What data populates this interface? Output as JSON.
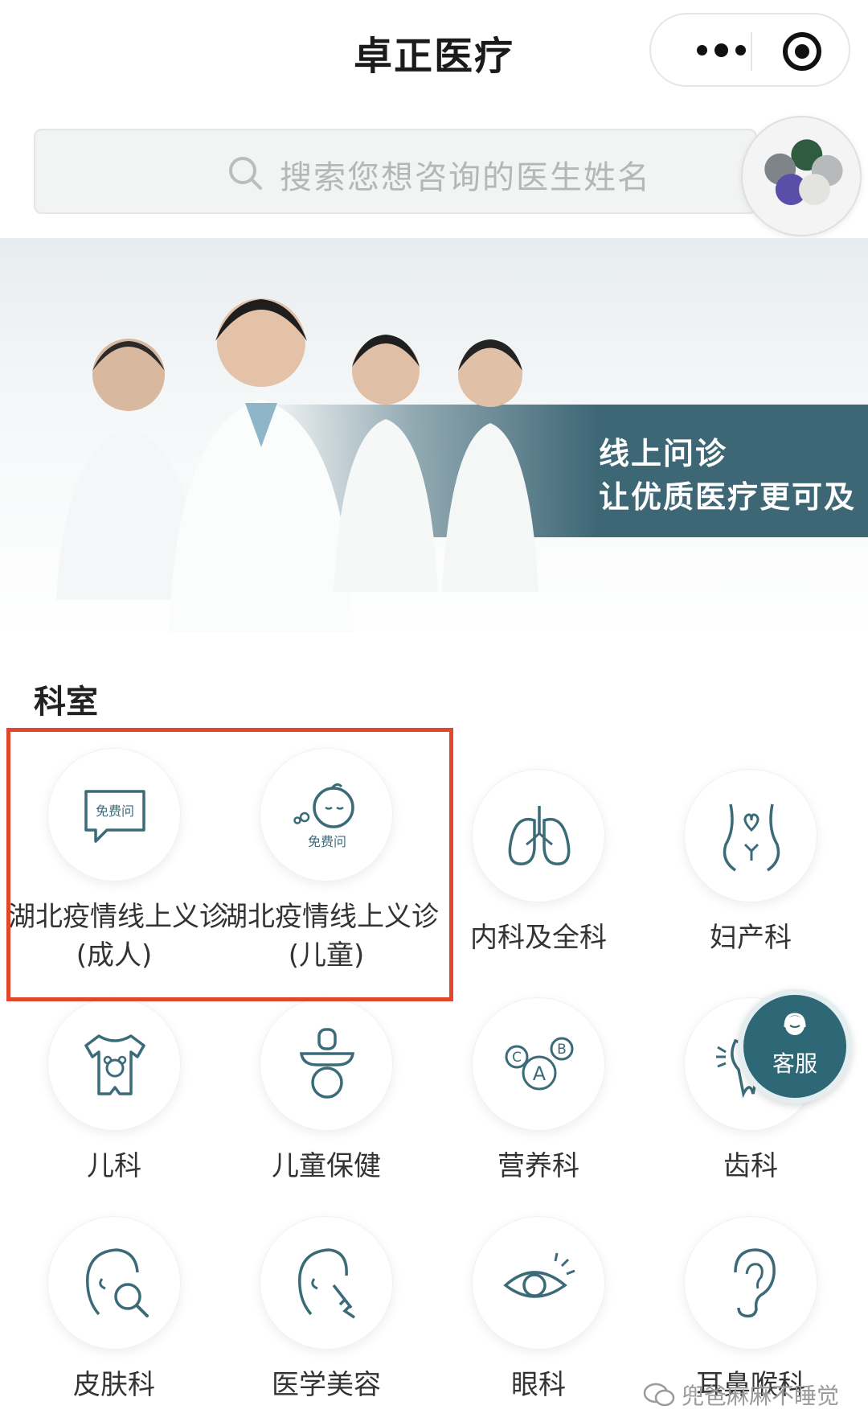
{
  "header": {
    "title": "卓正医疗"
  },
  "search": {
    "placeholder": "搜索您想咨询的医生姓名"
  },
  "banner": {
    "line1": "线上问诊",
    "line2": "让优质医疗更可及"
  },
  "section": {
    "title": "科室"
  },
  "departments": [
    {
      "label": "湖北疫情线上义诊",
      "sub": "(成人)",
      "icon": "free-consult-chat-icon",
      "badge": "免费问"
    },
    {
      "label": "湖北疫情线上义诊",
      "sub": "(儿童)",
      "icon": "baby-face-icon",
      "badge": "免费问"
    },
    {
      "label": "内科及全科",
      "icon": "lungs-icon"
    },
    {
      "label": "妇产科",
      "icon": "uterus-icon"
    },
    {
      "label": "儿科",
      "icon": "baby-onesie-icon"
    },
    {
      "label": "儿童保健",
      "icon": "pacifier-icon"
    },
    {
      "label": "营养科",
      "icon": "vitamins-abc-icon"
    },
    {
      "label": "齿科",
      "icon": "tooth-icon"
    },
    {
      "label": "皮肤科",
      "icon": "face-magnifier-icon"
    },
    {
      "label": "医学美容",
      "icon": "face-syringe-icon"
    },
    {
      "label": "眼科",
      "icon": "eye-icon"
    },
    {
      "label": "耳鼻喉科",
      "icon": "ear-icon"
    }
  ],
  "floating": {
    "customer_service": "客服"
  },
  "watermark": {
    "text": "兜爸麻麻不睡觉"
  },
  "colors": {
    "accent": "#3e6776",
    "highlight": "#e2462b",
    "icon_stroke": "#3b6b78"
  }
}
